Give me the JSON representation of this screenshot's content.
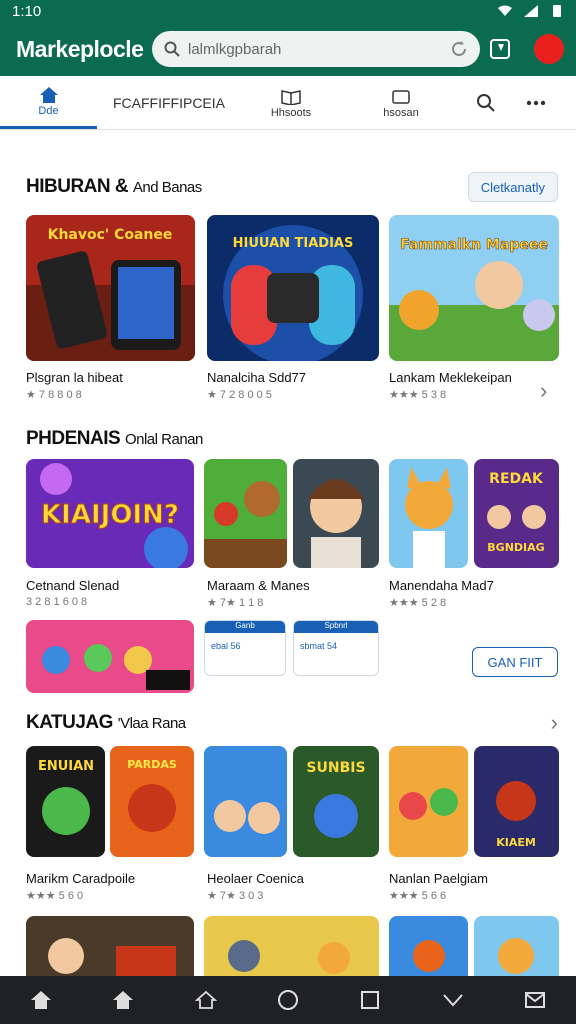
{
  "status_bar": {
    "time": "1:10"
  },
  "header": {
    "title": "Markeplocle",
    "search_placeholder": "lalmlkgpbarah"
  },
  "tabs": [
    {
      "label": "Dde"
    },
    {
      "label": "FCAFFIFFIPCEIA"
    },
    {
      "label": "Hhsoots"
    },
    {
      "label": "hsosan"
    }
  ],
  "sections": [
    {
      "title": "HIBURAN & ",
      "subtitle": "And Banas",
      "action": "Cletkanatly"
    },
    {
      "title": "PHDENAIS ",
      "subtitle": "Onlal Ranan"
    },
    {
      "title": "KATUJAG ",
      "subtitle": "'Vlaa Rana"
    }
  ],
  "row1": [
    {
      "title": "Plsgran la hibeat",
      "rating": "★ 7 8 8 0 8"
    },
    {
      "title": "Nanalciha Sdd77",
      "rating": "★ 7 2 8 0 0 5"
    },
    {
      "title": "Lankam Meklekeipan",
      "rating": "★★★ 5 3 8"
    }
  ],
  "row2": [
    {
      "title": "Cetnand Slenad",
      "rating": "3 2 8 1 6 0 8"
    },
    {
      "title": "Maraam & Manes",
      "rating": "★ 7★ 1 1 8"
    },
    {
      "title": "Manendaha Mad7",
      "rating": "★★★ 5 2 8"
    }
  ],
  "mini_cards": [
    {
      "top": "Ganb",
      "body": "ebal 56"
    },
    {
      "top": "Spbnrl",
      "body": "sbmat 54"
    }
  ],
  "ghost_button": "GAN FIIT",
  "row3": [
    {
      "title": "Marikm Caradpoile",
      "rating": "★★★ 5 6 0"
    },
    {
      "title": "Heolaer Coenica",
      "rating": "★ 7★ 3 0 3"
    },
    {
      "title": "Nanlan Paelgiam",
      "rating": "★★★ 5 6 6"
    }
  ],
  "art_text": {
    "a1": "Khavoc' Coanee",
    "a2": "HIUUAN TIADIAS",
    "a3": "Fammalkn Mapeee",
    "b1": "KIAIJOIN?",
    "b2": "REDAK",
    "b3": "BGNDIAG",
    "c1": "ENUIAN",
    "c2": "PARDAS",
    "c3": "SUNBIS",
    "c4": "KIAEM"
  },
  "colors": {
    "brand": "#0b6b4e",
    "accent": "#1760b6",
    "avatar": "#e8211f"
  }
}
